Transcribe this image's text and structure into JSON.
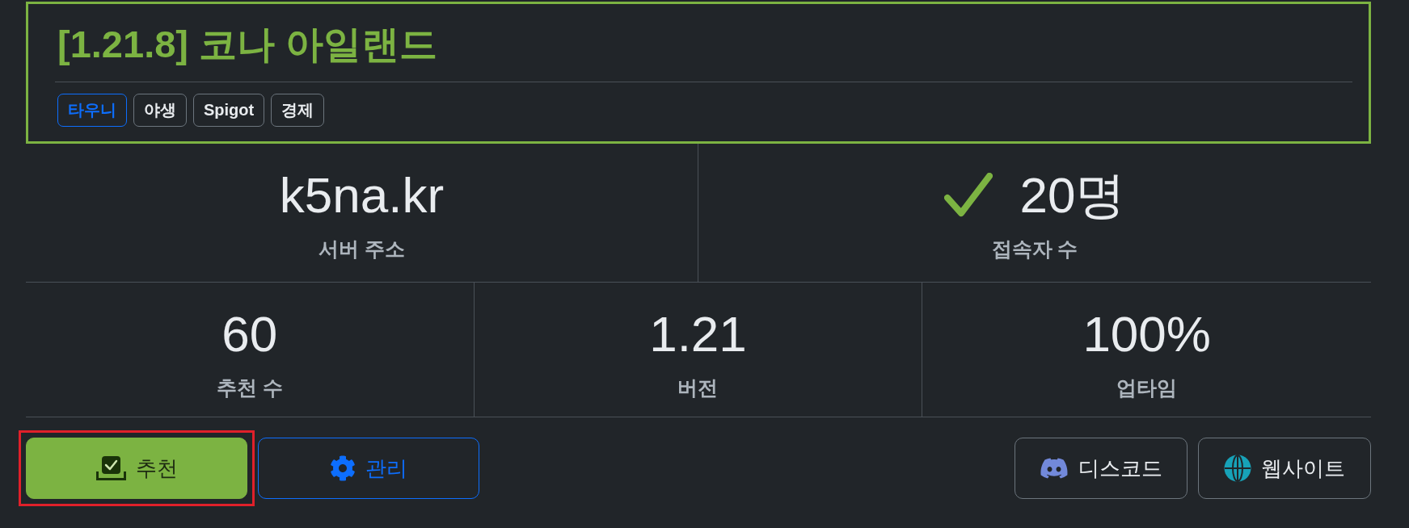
{
  "server": {
    "title": "[1.21.8] 코나 아일랜드",
    "tags": [
      {
        "label": "타우니",
        "kind": "primary"
      },
      {
        "label": "야생",
        "kind": "secondary"
      },
      {
        "label": "Spigot",
        "kind": "secondary"
      },
      {
        "label": "경제",
        "kind": "secondary"
      }
    ]
  },
  "address": {
    "value": "k5na.kr",
    "label": "서버 주소"
  },
  "players": {
    "value": "20명",
    "label": "접속자 수",
    "online": true
  },
  "stats": [
    {
      "value": "60",
      "label": "추천 수"
    },
    {
      "value": "1.21",
      "label": "버전"
    },
    {
      "value": "100%",
      "label": "업타임"
    }
  ],
  "actions": [
    {
      "kind": "recommend",
      "label": "추천",
      "highlighted": true
    },
    {
      "kind": "manage",
      "label": "관리",
      "highlighted": false
    }
  ],
  "links": [
    {
      "kind": "discord",
      "label": "디스코드"
    },
    {
      "kind": "website",
      "label": "웹사이트"
    }
  ]
}
